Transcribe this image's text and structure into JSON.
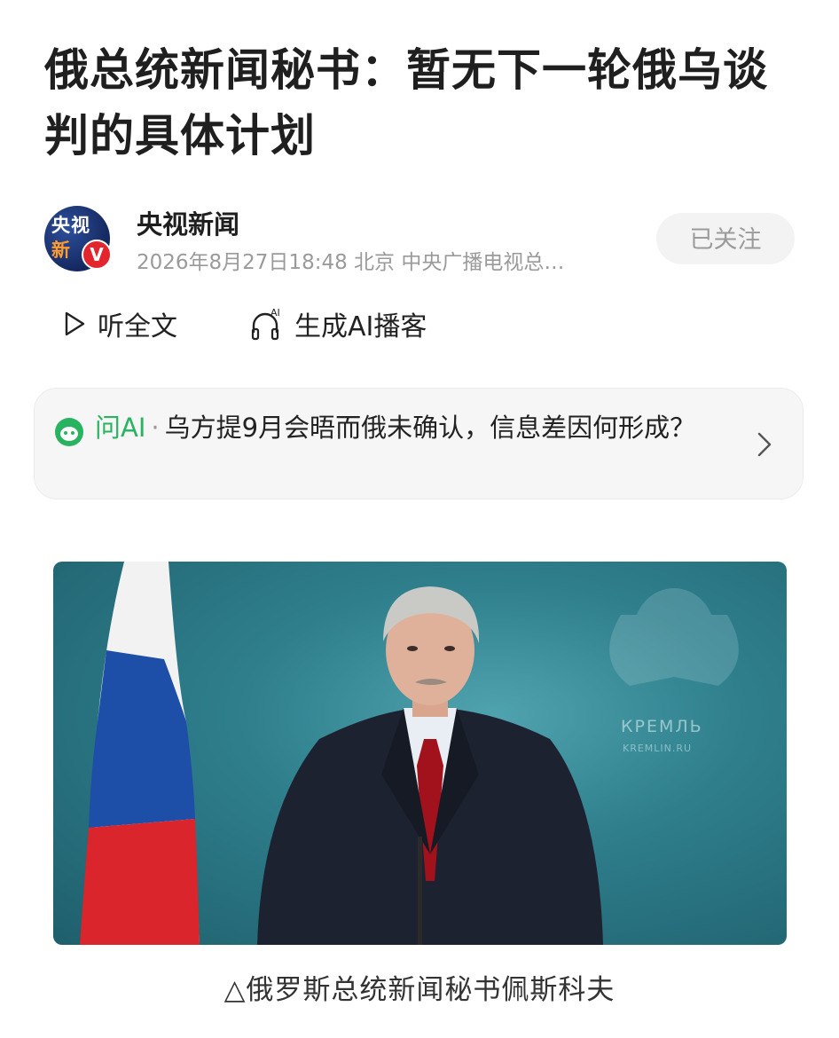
{
  "article": {
    "title": "俄总统新闻秘书：暂无下一轮俄乌谈判的具体计划"
  },
  "author": {
    "avatar_text_top": "央视",
    "avatar_text_bottom": "新",
    "verified_mark": "V",
    "name": "央视新闻",
    "meta": "2026年8月27日18:48 北京 中央广播电视总…",
    "follow_label": "已关注"
  },
  "actions": {
    "listen_label": "听全文",
    "podcast_label": "生成AI播客",
    "podcast_badge": "AI"
  },
  "ask_ai": {
    "label": "问AI",
    "separator": "·",
    "question": "乌方提9月会晤而俄未确认，信息差因何形成？"
  },
  "photo": {
    "backdrop_text_line1": "КРЕМЛЬ",
    "backdrop_text_line2": "KREMLIN.RU",
    "caption": "△俄罗斯总统新闻秘书佩斯科夫"
  },
  "colors": {
    "ai_green": "#27b35f",
    "verified_red": "#e3262d",
    "follow_bg": "#f3f3f3"
  }
}
